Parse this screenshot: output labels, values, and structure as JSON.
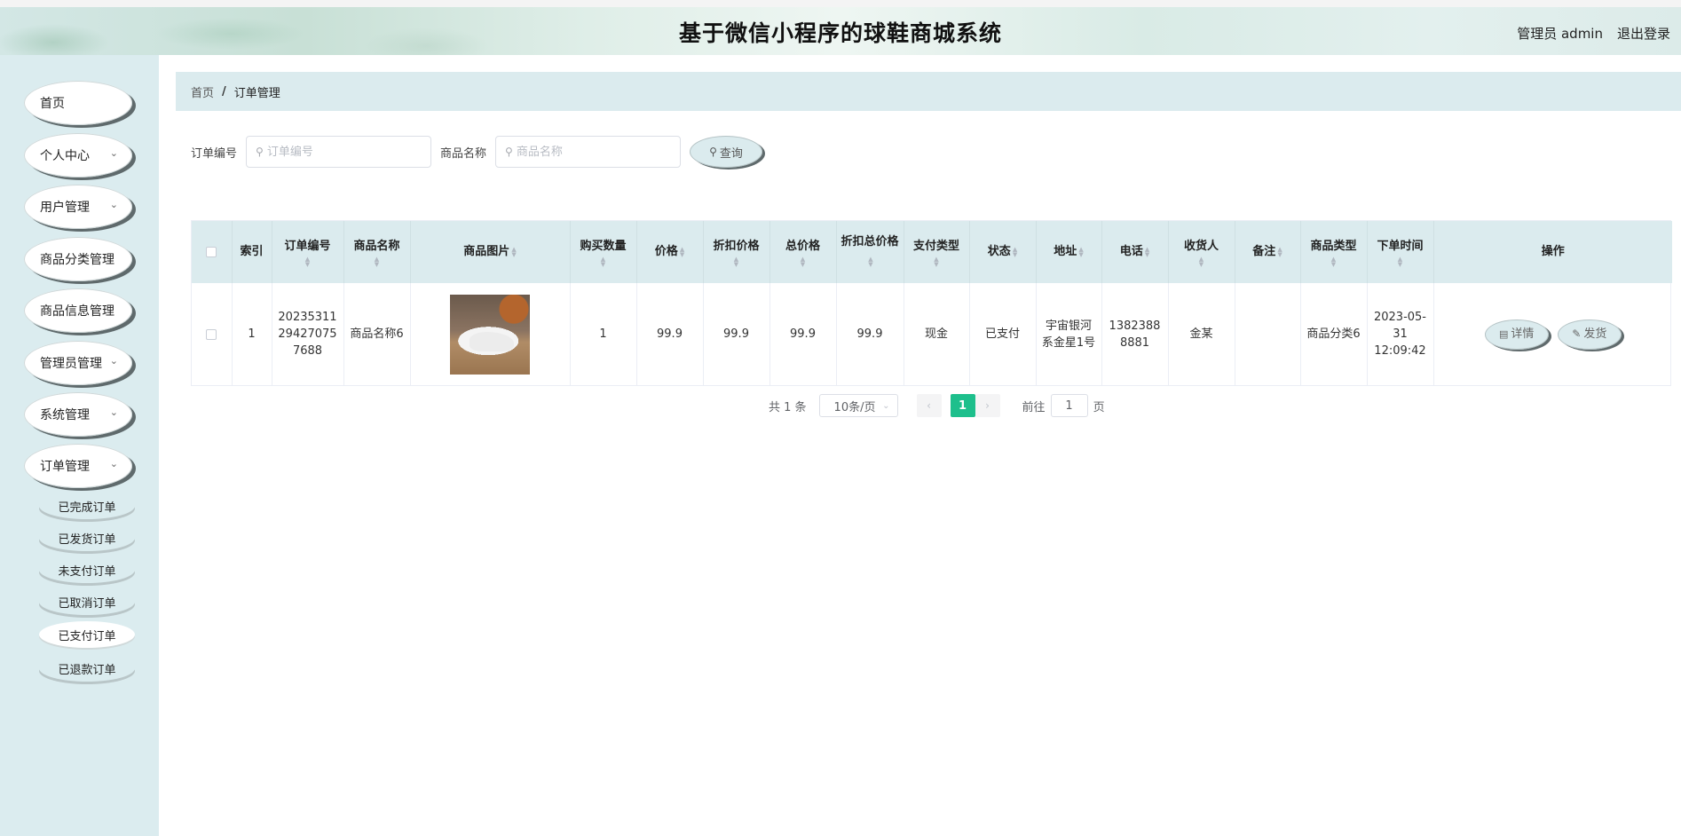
{
  "header": {
    "title": "基于微信小程序的球鞋商城系统",
    "user": "管理员 admin",
    "logout": "退出登录"
  },
  "sidebar": {
    "items": [
      {
        "label": "首页",
        "has_children": false
      },
      {
        "label": "个人中心",
        "has_children": true
      },
      {
        "label": "用户管理",
        "has_children": true
      },
      {
        "label": "商品分类管理",
        "has_children": true
      },
      {
        "label": "商品信息管理",
        "has_children": true
      },
      {
        "label": "管理员管理",
        "has_children": true
      },
      {
        "label": "系统管理",
        "has_children": true
      },
      {
        "label": "订单管理",
        "has_children": true
      }
    ],
    "sub_items": [
      {
        "label": "已完成订单"
      },
      {
        "label": "已发货订单"
      },
      {
        "label": "未支付订单"
      },
      {
        "label": "已取消订单"
      },
      {
        "label": "已支付订单",
        "active": true
      },
      {
        "label": "已退款订单"
      }
    ]
  },
  "breadcrumb": {
    "home": "首页",
    "separator": "/",
    "current": "订单管理"
  },
  "search": {
    "order_no_label": "订单编号",
    "order_no_placeholder": "订单编号",
    "product_name_label": "商品名称",
    "product_name_placeholder": "商品名称",
    "query_button": "查询"
  },
  "table": {
    "headers": {
      "index": "索引",
      "order_no": "订单编号",
      "product_name": "商品名称",
      "product_image": "商品图片",
      "quantity": "购买数量",
      "price": "价格",
      "discount_price": "折扣价格",
      "total_price": "总价格",
      "discount_total": "折扣总价格",
      "pay_type": "支付类型",
      "status": "状态",
      "address": "地址",
      "phone": "电话",
      "receiver": "收货人",
      "remark": "备注",
      "product_type": "商品类型",
      "order_time": "下单时间",
      "actions": "操作"
    },
    "rows": [
      {
        "index": "1",
        "order_no": "2023531129427075 7688",
        "product_name": "商品名称6",
        "quantity": "1",
        "price": "99.9",
        "discount_price": "99.9",
        "total_price": "99.9",
        "discount_total": "99.9",
        "pay_type": "现金",
        "status": "已支付",
        "address": "宇宙银河系金星1号",
        "phone": "13823888881",
        "receiver": "金某",
        "remark": "",
        "product_type": "商品分类6",
        "order_time": "2023-05-31 12:09:42",
        "detail_button": "详情",
        "ship_button": "发货"
      }
    ]
  },
  "pagination": {
    "total": "共 1 条",
    "page_size": "10条/页",
    "current_page": "1",
    "goto_prefix": "前往",
    "goto_value": "1",
    "goto_suffix": "页"
  },
  "colors": {
    "sidebar_bg": "#dbecef",
    "header_row_bg": "#dbebee",
    "active_page": "#1dbf8c"
  }
}
